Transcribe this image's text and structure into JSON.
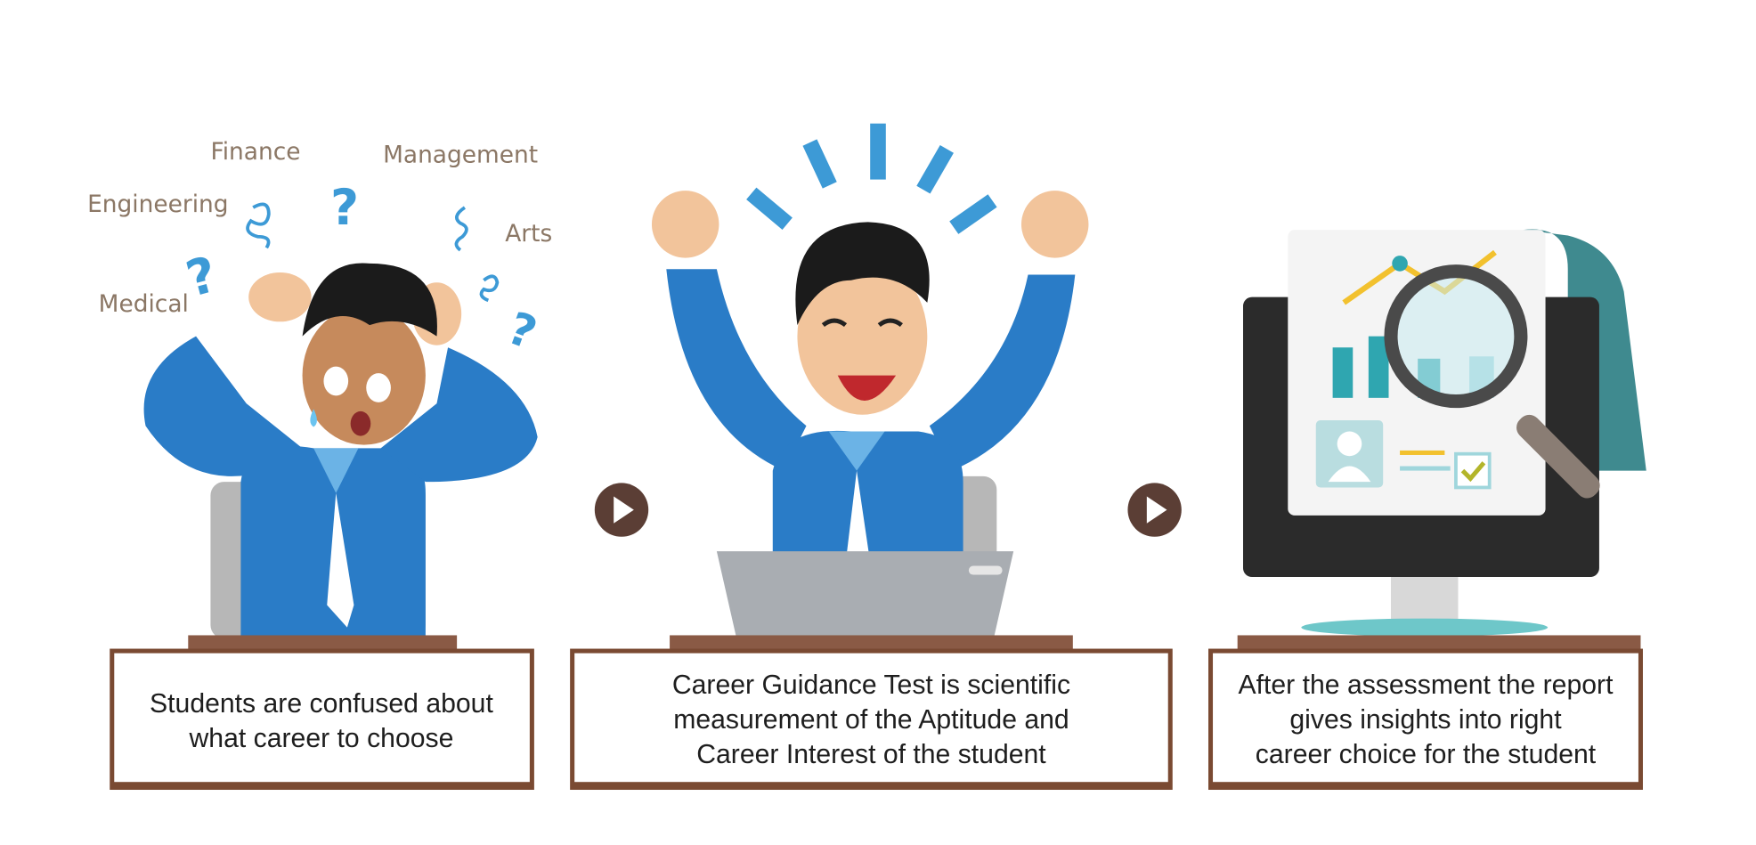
{
  "career_options": [
    "Finance",
    "Management",
    "Engineering",
    "Arts",
    "Medical"
  ],
  "steps": [
    {
      "caption_lines": [
        "Students are confused about",
        "what career to choose"
      ]
    },
    {
      "caption_lines": [
        "Career Guidance Test  is scientific",
        "measurement of the Aptitude and",
        "Career Interest of the student"
      ]
    },
    {
      "caption_lines": [
        "After the assessment the report",
        "gives insights into right",
        "career choice for the student"
      ]
    }
  ],
  "colors": {
    "shirt": "#2a7cc7",
    "skin": "#f2c49b",
    "hair": "#1b1b1b",
    "frame": "#7a4a32",
    "arrow": "#5b3e35",
    "accent": "#3d9ad6",
    "label": "#8b7765"
  }
}
